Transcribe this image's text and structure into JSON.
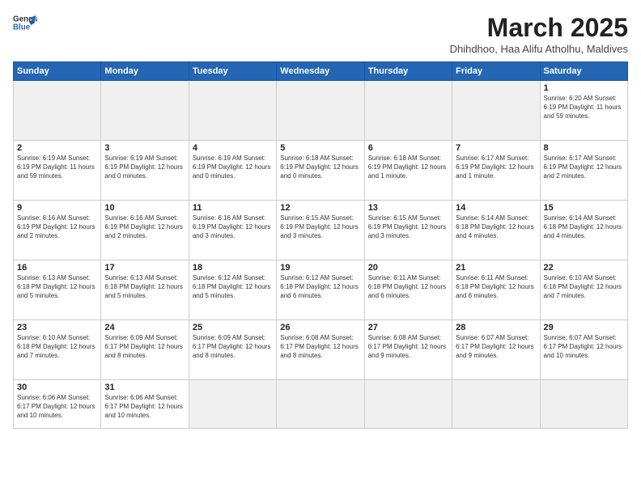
{
  "logo": {
    "line1": "General",
    "line2": "Blue"
  },
  "title": "March 2025",
  "subtitle": "Dhihdhoo, Haa Alifu Atholhu, Maldives",
  "weekdays": [
    "Sunday",
    "Monday",
    "Tuesday",
    "Wednesday",
    "Thursday",
    "Friday",
    "Saturday"
  ],
  "weeks": [
    [
      {
        "day": "",
        "info": ""
      },
      {
        "day": "",
        "info": ""
      },
      {
        "day": "",
        "info": ""
      },
      {
        "day": "",
        "info": ""
      },
      {
        "day": "",
        "info": ""
      },
      {
        "day": "",
        "info": ""
      },
      {
        "day": "1",
        "info": "Sunrise: 6:20 AM\nSunset: 6:19 PM\nDaylight: 11 hours and 59 minutes."
      }
    ],
    [
      {
        "day": "2",
        "info": "Sunrise: 6:19 AM\nSunset: 6:19 PM\nDaylight: 11 hours and 59 minutes."
      },
      {
        "day": "3",
        "info": "Sunrise: 6:19 AM\nSunset: 6:19 PM\nDaylight: 12 hours and 0 minutes."
      },
      {
        "day": "4",
        "info": "Sunrise: 6:19 AM\nSunset: 6:19 PM\nDaylight: 12 hours and 0 minutes."
      },
      {
        "day": "5",
        "info": "Sunrise: 6:18 AM\nSunset: 6:19 PM\nDaylight: 12 hours and 0 minutes."
      },
      {
        "day": "6",
        "info": "Sunrise: 6:18 AM\nSunset: 6:19 PM\nDaylight: 12 hours and 1 minute."
      },
      {
        "day": "7",
        "info": "Sunrise: 6:17 AM\nSunset: 6:19 PM\nDaylight: 12 hours and 1 minute."
      },
      {
        "day": "8",
        "info": "Sunrise: 6:17 AM\nSunset: 6:19 PM\nDaylight: 12 hours and 2 minutes."
      }
    ],
    [
      {
        "day": "9",
        "info": "Sunrise: 6:16 AM\nSunset: 6:19 PM\nDaylight: 12 hours and 2 minutes."
      },
      {
        "day": "10",
        "info": "Sunrise: 6:16 AM\nSunset: 6:19 PM\nDaylight: 12 hours and 2 minutes."
      },
      {
        "day": "11",
        "info": "Sunrise: 6:16 AM\nSunset: 6:19 PM\nDaylight: 12 hours and 3 minutes."
      },
      {
        "day": "12",
        "info": "Sunrise: 6:15 AM\nSunset: 6:19 PM\nDaylight: 12 hours and 3 minutes."
      },
      {
        "day": "13",
        "info": "Sunrise: 6:15 AM\nSunset: 6:19 PM\nDaylight: 12 hours and 3 minutes."
      },
      {
        "day": "14",
        "info": "Sunrise: 6:14 AM\nSunset: 6:18 PM\nDaylight: 12 hours and 4 minutes."
      },
      {
        "day": "15",
        "info": "Sunrise: 6:14 AM\nSunset: 6:18 PM\nDaylight: 12 hours and 4 minutes."
      }
    ],
    [
      {
        "day": "16",
        "info": "Sunrise: 6:13 AM\nSunset: 6:18 PM\nDaylight: 12 hours and 5 minutes."
      },
      {
        "day": "17",
        "info": "Sunrise: 6:13 AM\nSunset: 6:18 PM\nDaylight: 12 hours and 5 minutes."
      },
      {
        "day": "18",
        "info": "Sunrise: 6:12 AM\nSunset: 6:18 PM\nDaylight: 12 hours and 5 minutes."
      },
      {
        "day": "19",
        "info": "Sunrise: 6:12 AM\nSunset: 6:18 PM\nDaylight: 12 hours and 6 minutes."
      },
      {
        "day": "20",
        "info": "Sunrise: 6:11 AM\nSunset: 6:18 PM\nDaylight: 12 hours and 6 minutes."
      },
      {
        "day": "21",
        "info": "Sunrise: 6:11 AM\nSunset: 6:18 PM\nDaylight: 12 hours and 6 minutes."
      },
      {
        "day": "22",
        "info": "Sunrise: 6:10 AM\nSunset: 6:18 PM\nDaylight: 12 hours and 7 minutes."
      }
    ],
    [
      {
        "day": "23",
        "info": "Sunrise: 6:10 AM\nSunset: 6:18 PM\nDaylight: 12 hours and 7 minutes."
      },
      {
        "day": "24",
        "info": "Sunrise: 6:09 AM\nSunset: 6:17 PM\nDaylight: 12 hours and 8 minutes."
      },
      {
        "day": "25",
        "info": "Sunrise: 6:09 AM\nSunset: 6:17 PM\nDaylight: 12 hours and 8 minutes."
      },
      {
        "day": "26",
        "info": "Sunrise: 6:08 AM\nSunset: 6:17 PM\nDaylight: 12 hours and 8 minutes."
      },
      {
        "day": "27",
        "info": "Sunrise: 6:08 AM\nSunset: 6:17 PM\nDaylight: 12 hours and 9 minutes."
      },
      {
        "day": "28",
        "info": "Sunrise: 6:07 AM\nSunset: 6:17 PM\nDaylight: 12 hours and 9 minutes."
      },
      {
        "day": "29",
        "info": "Sunrise: 6:07 AM\nSunset: 6:17 PM\nDaylight: 12 hours and 10 minutes."
      }
    ],
    [
      {
        "day": "30",
        "info": "Sunrise: 6:06 AM\nSunset: 6:17 PM\nDaylight: 12 hours and 10 minutes."
      },
      {
        "day": "31",
        "info": "Sunrise: 6:06 AM\nSunset: 6:17 PM\nDaylight: 12 hours and 10 minutes."
      },
      {
        "day": "",
        "info": ""
      },
      {
        "day": "",
        "info": ""
      },
      {
        "day": "",
        "info": ""
      },
      {
        "day": "",
        "info": ""
      },
      {
        "day": "",
        "info": ""
      }
    ]
  ]
}
